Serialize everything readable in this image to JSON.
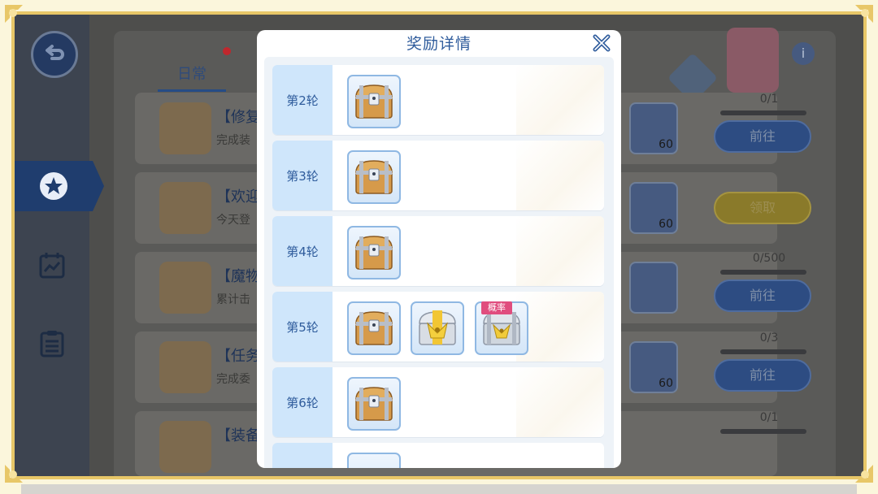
{
  "modal": {
    "title": "奖励详情",
    "rounds": [
      {
        "label": "第2轮",
        "rewards": [
          {
            "type": "wooden-chest"
          }
        ]
      },
      {
        "label": "第3轮",
        "rewards": [
          {
            "type": "wooden-chest"
          }
        ]
      },
      {
        "label": "第4轮",
        "rewards": [
          {
            "type": "wooden-chest"
          }
        ]
      },
      {
        "label": "第5轮",
        "rewards": [
          {
            "type": "wooden-chest"
          },
          {
            "type": "gold-chest"
          },
          {
            "type": "silver-chest",
            "badge": "概率"
          }
        ]
      },
      {
        "label": "第6轮",
        "rewards": [
          {
            "type": "wooden-chest"
          }
        ]
      }
    ]
  },
  "background": {
    "tab_daily": "日常",
    "tasks": [
      {
        "title": "【修复",
        "desc": "完成装",
        "gem_count": "60",
        "progress": "0/1",
        "button": "前往"
      },
      {
        "title": "【欢迎",
        "desc": "今天登",
        "gem_count": "60",
        "progress": "",
        "button": "领取"
      },
      {
        "title": "【魔物",
        "desc": "累计击",
        "gem_count": "",
        "progress": "0/500",
        "button": "前往"
      },
      {
        "title": "【任务",
        "desc": "完成委",
        "gem_count": "60",
        "progress": "0/3",
        "button": "前往"
      },
      {
        "title": "【装备",
        "desc": "",
        "gem_count": "",
        "progress": "0/1",
        "button": ""
      }
    ],
    "info_label": "i"
  },
  "colors": {
    "accent_blue": "#2f5c9c",
    "frame_gold": "#e8c768",
    "badge_pink": "#e04d7e"
  }
}
